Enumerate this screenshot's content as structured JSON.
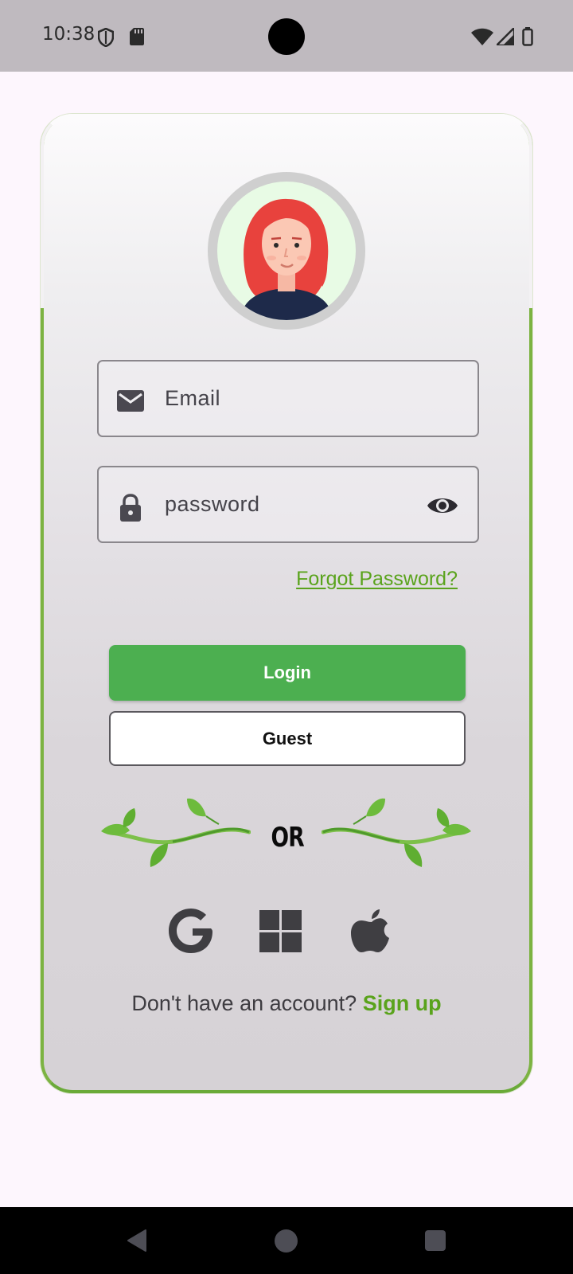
{
  "status_bar": {
    "time": "10:38",
    "icons": [
      "shield-icon",
      "sd-card-icon",
      "wifi-icon",
      "signal-icon",
      "battery-icon"
    ]
  },
  "login": {
    "avatar": "avatar-woman-red-hair",
    "email_placeholder": "Email",
    "password_placeholder": "password",
    "forgot_password": "Forgot Password?",
    "login_label": "Login",
    "guest_label": "Guest",
    "or_label": "OR",
    "social": [
      "google-icon",
      "windows-icon",
      "apple-icon"
    ],
    "no_account_text": "Don't have an account? ",
    "signup_label": "Sign up"
  },
  "nav": [
    "back-icon",
    "home-icon",
    "recents-icon"
  ],
  "colors": {
    "accent_green": "#4caf50",
    "link_green": "#5aa31c",
    "card_border": "#7cb342",
    "status_bar_bg": "#bfbabf",
    "page_bg": "#fdf6fd"
  }
}
